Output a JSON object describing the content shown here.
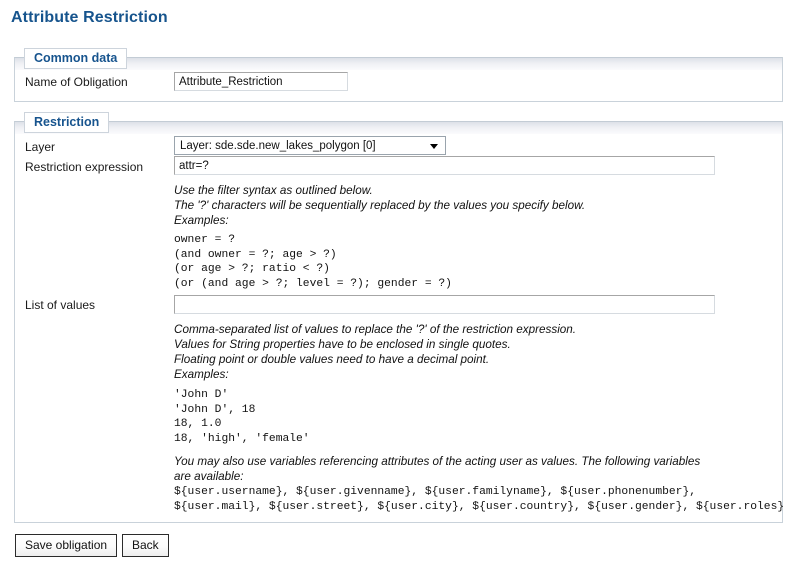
{
  "page": {
    "title": "Attribute Restriction"
  },
  "common_data": {
    "legend": "Common data",
    "name_label": "Name of Obligation",
    "name_value": "Attribute_Restriction",
    "name_placeholder": ""
  },
  "restriction": {
    "legend": "Restriction",
    "layer_label": "Layer",
    "layer_selected": "Layer: sde.sde.new_lakes_polygon [0]",
    "layer_options": [
      "Layer: sde.sde.new_lakes_polygon [0]"
    ],
    "expression_label": "Restriction expression",
    "expression_value": "attr=?",
    "expression_placeholder": "",
    "expression_help": "Use the filter syntax as outlined below.\nThe '?' characters will be sequentially replaced by the values you specify below.\nExamples:",
    "expression_examples": "owner = ?\n(and owner = ?; age > ?)\n(or age > ?; ratio < ?)\n(or (and age > ?; level = ?); gender = ?)",
    "values_label": "List of values",
    "values_value": "",
    "values_placeholder": "",
    "values_help": "Comma-separated list of values to replace the '?' of the restriction expression.\nValues for String properties have to be enclosed in single quotes.\nFloating point or double values need to have a decimal point.\nExamples:",
    "values_examples": "'John D'\n'John D', 18\n18, 1.0\n18, 'high', 'female'",
    "variables_help": "You may also use variables referencing attributes of the acting user as values. The following variables\nare available:",
    "variables_list": "${user.username}, ${user.givenname}, ${user.familyname}, ${user.phonenumber},\n${user.mail}, ${user.street}, ${user.city}, ${user.country}, ${user.gender}, ${user.roles}"
  },
  "actions": {
    "save_label": "Save obligation",
    "back_label": "Back"
  },
  "colors": {
    "title": "#16548d",
    "legend": "#17548e",
    "panel_border": "#c9d2da"
  }
}
